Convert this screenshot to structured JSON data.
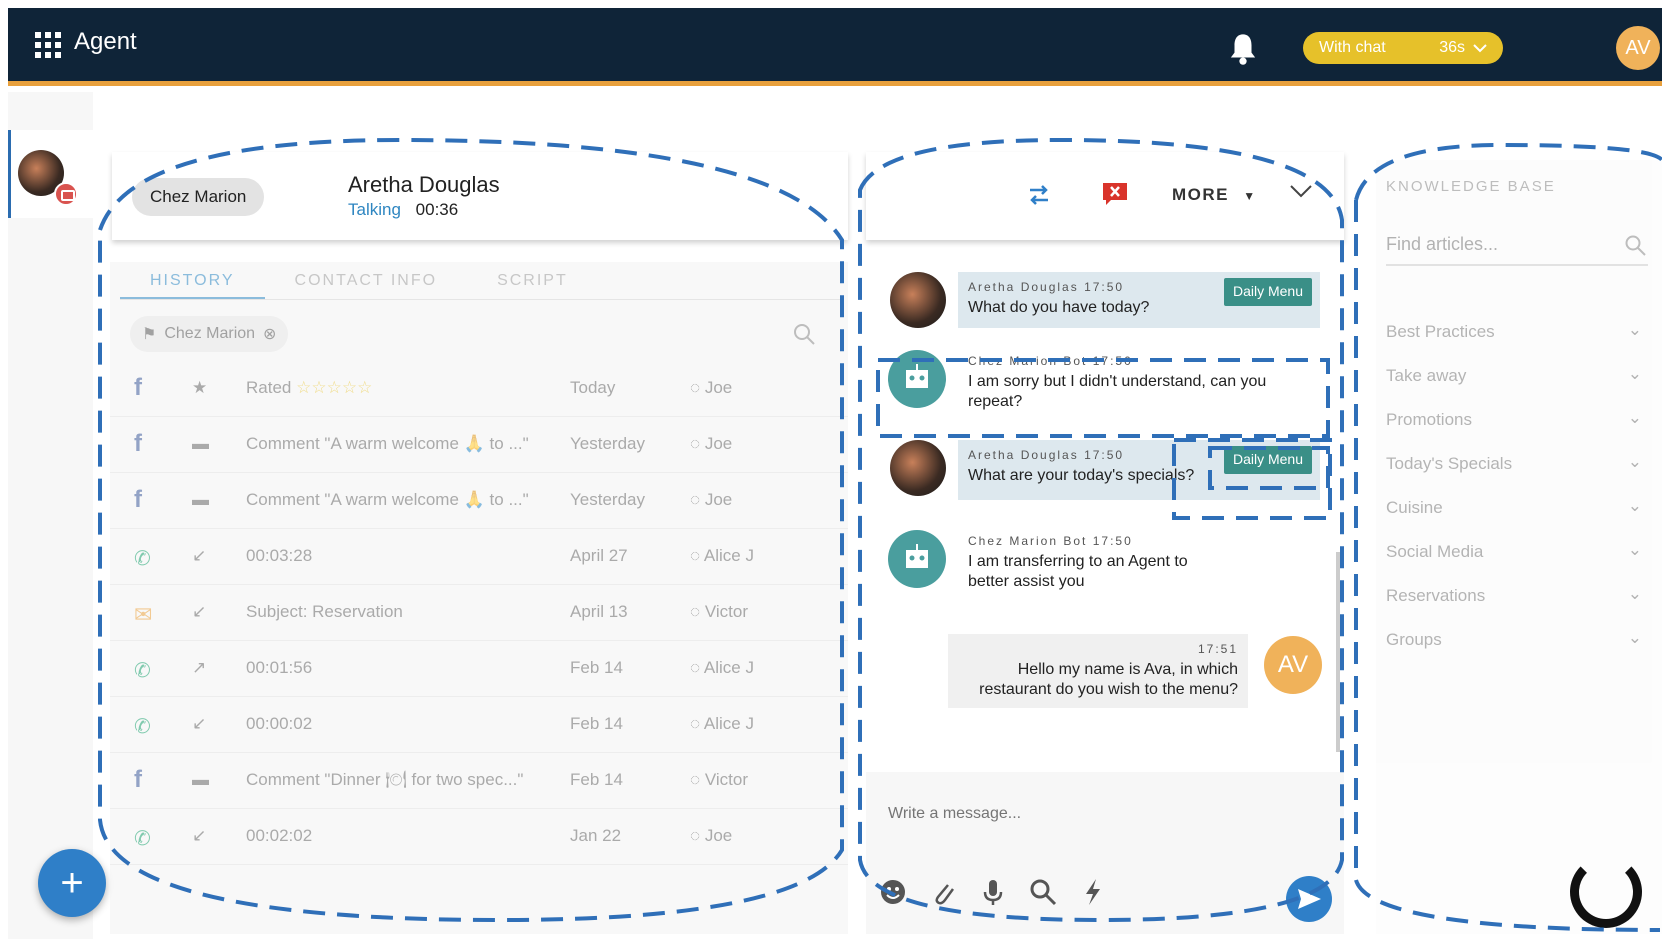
{
  "header": {
    "app_title": "Agent",
    "status_label": "With chat",
    "status_timer": "36s",
    "user_initials": "AV"
  },
  "contact": {
    "company_chip": "Chez Marion",
    "name": "Aretha Douglas",
    "state": "Talking",
    "duration": "00:36"
  },
  "history": {
    "tabs": [
      "HISTORY",
      "CONTACT INFO",
      "SCRIPT"
    ],
    "filter_chip": "Chez Marion",
    "rows": [
      {
        "channel": "facebook",
        "type": "star",
        "desc": "Rated",
        "date": "Today",
        "agent": "Joe",
        "stars": 5
      },
      {
        "channel": "facebook",
        "type": "comment",
        "desc": "Comment \"A warm welcome 🙏 to ...\"",
        "date": "Yesterday",
        "agent": "Joe"
      },
      {
        "channel": "facebook",
        "type": "comment",
        "desc": "Comment \"A warm welcome 🙏 to ...\"",
        "date": "Yesterday",
        "agent": "Joe"
      },
      {
        "channel": "phone",
        "type": "incoming",
        "desc": "00:03:28",
        "date": "April 27",
        "agent": "Alice J"
      },
      {
        "channel": "email",
        "type": "incoming",
        "desc": "Subject: Reservation",
        "date": "April 13",
        "agent": "Victor"
      },
      {
        "channel": "phone",
        "type": "outgoing",
        "desc": "00:01:56",
        "date": "Feb 14",
        "agent": "Alice J"
      },
      {
        "channel": "phone",
        "type": "incoming",
        "desc": "00:00:02",
        "date": "Feb 14",
        "agent": "Alice J"
      },
      {
        "channel": "facebook",
        "type": "comment",
        "desc": "Comment \"Dinner 🍽 for two spec...\"",
        "date": "Feb 14",
        "agent": "Victor"
      },
      {
        "channel": "phone",
        "type": "incoming",
        "desc": "00:02:02",
        "date": "Jan 22",
        "agent": "Joe"
      }
    ]
  },
  "chat": {
    "more_label": "MORE",
    "messages": [
      {
        "sender": "Aretha Douglas",
        "time": "17:50",
        "text": "What do you have today?",
        "tag": "Daily Menu"
      },
      {
        "sender": "Chez Marion Bot",
        "time": "17:50",
        "text": "I am sorry but I didn't understand, can you repeat?"
      },
      {
        "sender": "Aretha Douglas",
        "time": "17:50",
        "text": "What are your today's specials?",
        "tag": "Daily Menu"
      },
      {
        "sender": "Chez Marion Bot",
        "time": "17:50",
        "text": "I am transferring to an Agent to better assist you"
      },
      {
        "sender": "AV",
        "time": "17:51",
        "text": "Hello my name is Ava, in which restaurant do you wish to the menu?"
      }
    ],
    "composer_placeholder": "Write a message..."
  },
  "knowledge_base": {
    "title": "KNOWLEDGE BASE",
    "search_placeholder": "Find articles...",
    "categories": [
      "Best Practices",
      "Take away",
      "Promotions",
      "Today's Specials",
      "Cuisine",
      "Social Media",
      "Reservations",
      "Groups"
    ]
  },
  "colors": {
    "header_bg": "#0f2438",
    "accent": "#e8a03c",
    "status": "#e6c12a",
    "primary": "#2f7fc8",
    "tag": "#3a8f87"
  }
}
